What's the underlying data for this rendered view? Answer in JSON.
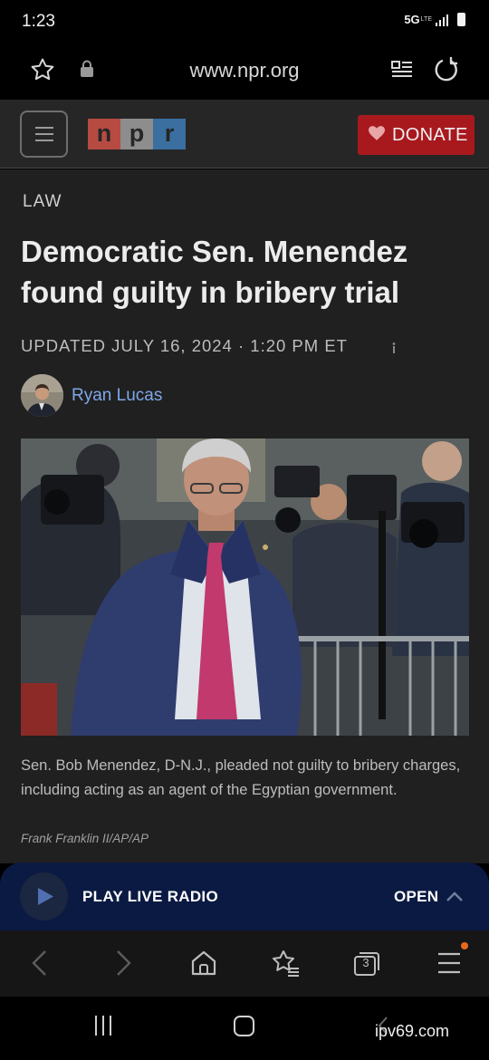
{
  "status_bar": {
    "time": "1:23",
    "network": "5G",
    "network_sub": "LTE"
  },
  "browser": {
    "url": "www.npr.org",
    "icons": {
      "bookmark": "star-icon",
      "secure": "lock-icon",
      "reader": "reader-mode-icon",
      "reload": "reload-icon"
    }
  },
  "header": {
    "logo_letters": [
      "n",
      "p",
      "r"
    ],
    "donate_label": "DONATE",
    "colors": {
      "logo_n": "#b64b42",
      "logo_p": "#8d8d8d",
      "logo_r": "#3a6fa0",
      "donate": "#a8191e"
    }
  },
  "article": {
    "section": "LAW",
    "headline": "Democratic Sen. Menendez found guilty in bribery trial",
    "dateline": "UPDATED JULY 16, 2024 · 1:20 PM ET",
    "author": "Ryan Lucas",
    "caption": "Sen. Bob Menendez, D-N.J., pleaded not guilty to bribery charges, including acting as an agent of the Egyptian government.",
    "credit": "Frank Franklin II/AP/AP"
  },
  "radio": {
    "label": "PLAY LIVE RADIO",
    "open_label": "OPEN",
    "color": "#0b1a42"
  },
  "toolbar": {
    "tab_count": "3",
    "items": [
      "back-icon",
      "forward-icon",
      "home-icon",
      "bookmarks-icon",
      "tabs-icon",
      "menu-icon"
    ]
  },
  "android_nav": {
    "items": [
      "recents-icon",
      "home-button-icon",
      "back-icon"
    ]
  },
  "watermark": "ipv69.com"
}
